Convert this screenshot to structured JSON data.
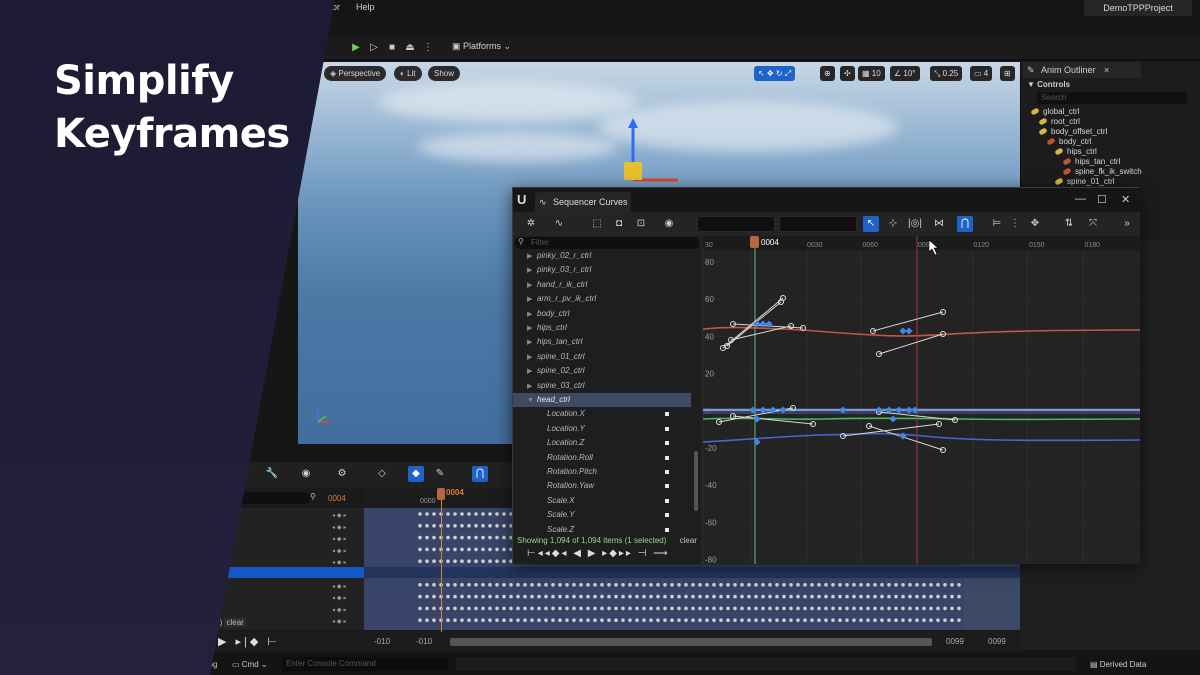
{
  "menu": {
    "partial_left": "or",
    "help": "Help"
  },
  "project": "DemoTPPProject",
  "main_toolbar": {
    "platforms": "Platforms"
  },
  "viewport": {
    "perspective": "Perspective",
    "lit": "Lit",
    "show": "Show",
    "grid_snap": "10",
    "rot_snap": "10°",
    "scale_snap": "0.25",
    "cam_speed": "4"
  },
  "overlay": {
    "line1": "Simplify",
    "line2": "Keyframes"
  },
  "outliner": {
    "title": "Anim Outliner",
    "section": "Controls",
    "search_placeholder": "Search",
    "items": [
      {
        "label": "global_ctrl",
        "indent": 0,
        "color": "yellow"
      },
      {
        "label": "root_ctrl",
        "indent": 1,
        "color": "yellow"
      },
      {
        "label": "body_offset_ctrl",
        "indent": 1,
        "color": "yellow"
      },
      {
        "label": "body_ctrl",
        "indent": 2,
        "color": "red"
      },
      {
        "label": "hips_ctrl",
        "indent": 3,
        "color": "yellow"
      },
      {
        "label": "hips_tan_ctrl",
        "indent": 4,
        "color": "red"
      },
      {
        "label": "spine_fk_ik_switch",
        "indent": 4,
        "color": "red"
      },
      {
        "label": "spine_01_ctrl",
        "indent": 3,
        "color": "yellow"
      }
    ]
  },
  "curves": {
    "title": "Sequencer Curves",
    "filter_placeholder": "Filter",
    "tree": [
      {
        "label": "pinky_02_r_ctrl",
        "arrow": "▶",
        "child": false,
        "selected": false
      },
      {
        "label": "pinky_03_r_ctrl",
        "arrow": "▶",
        "child": false,
        "selected": false
      },
      {
        "label": "hand_r_ik_ctrl",
        "arrow": "▶",
        "child": false,
        "selected": false
      },
      {
        "label": "arm_r_pv_ik_ctrl",
        "arrow": "▶",
        "child": false,
        "selected": false
      },
      {
        "label": "body_ctrl",
        "arrow": "▶",
        "child": false,
        "selected": false
      },
      {
        "label": "hips_ctrl",
        "arrow": "▶",
        "child": false,
        "selected": false
      },
      {
        "label": "hips_tan_ctrl",
        "arrow": "▶",
        "child": false,
        "selected": false
      },
      {
        "label": "spine_01_ctrl",
        "arrow": "▶",
        "child": false,
        "selected": false
      },
      {
        "label": "spine_02_ctrl",
        "arrow": "▶",
        "child": false,
        "selected": false
      },
      {
        "label": "spine_03_ctrl",
        "arrow": "▶",
        "child": false,
        "selected": false
      },
      {
        "label": "head_ctrl",
        "arrow": "▼",
        "child": false,
        "selected": true
      },
      {
        "label": "Location.X",
        "arrow": "",
        "child": true,
        "selected": false
      },
      {
        "label": "Location.Y",
        "arrow": "",
        "child": true,
        "selected": false
      },
      {
        "label": "Location.Z",
        "arrow": "",
        "child": true,
        "selected": false
      },
      {
        "label": "Rotation.Roll",
        "arrow": "",
        "child": true,
        "selected": false
      },
      {
        "label": "Rotation.Pitch",
        "arrow": "",
        "child": true,
        "selected": false
      },
      {
        "label": "Rotation.Yaw",
        "arrow": "",
        "child": true,
        "selected": false
      },
      {
        "label": "Scale.X",
        "arrow": "",
        "child": true,
        "selected": false
      },
      {
        "label": "Scale.Y",
        "arrow": "",
        "child": true,
        "selected": false
      },
      {
        "label": "Scale.Z",
        "arrow": "",
        "child": true,
        "selected": false
      }
    ],
    "status": "Showing 1,094 of 1,094 items (1 selected)",
    "clear": "clear",
    "current_frame": "0004",
    "ruler": [
      "0030",
      "0060",
      "0090",
      "0120",
      "0150",
      "0180"
    ],
    "y_ticks": [
      "80",
      "60",
      "40",
      "20",
      "0",
      "-20",
      "-40",
      "-60",
      "-80"
    ]
  },
  "sequencer": {
    "current_frame": "0004",
    "frame_label": "0000",
    "selected_partial": "ected)",
    "clear": "clear",
    "range_start": "-010",
    "range_start2": "-010",
    "range_end": "0099",
    "range_end2": "0099"
  },
  "statusbar": {
    "log": "Log",
    "cmd": "Cmd",
    "console_placeholder": "Enter Console Command",
    "derived": "Derived Data"
  },
  "colors": {
    "accent": "#1e64c8",
    "red_curve": "#c0574b",
    "green_curve": "#4fb85a",
    "blue_curve": "#4b63d6"
  }
}
